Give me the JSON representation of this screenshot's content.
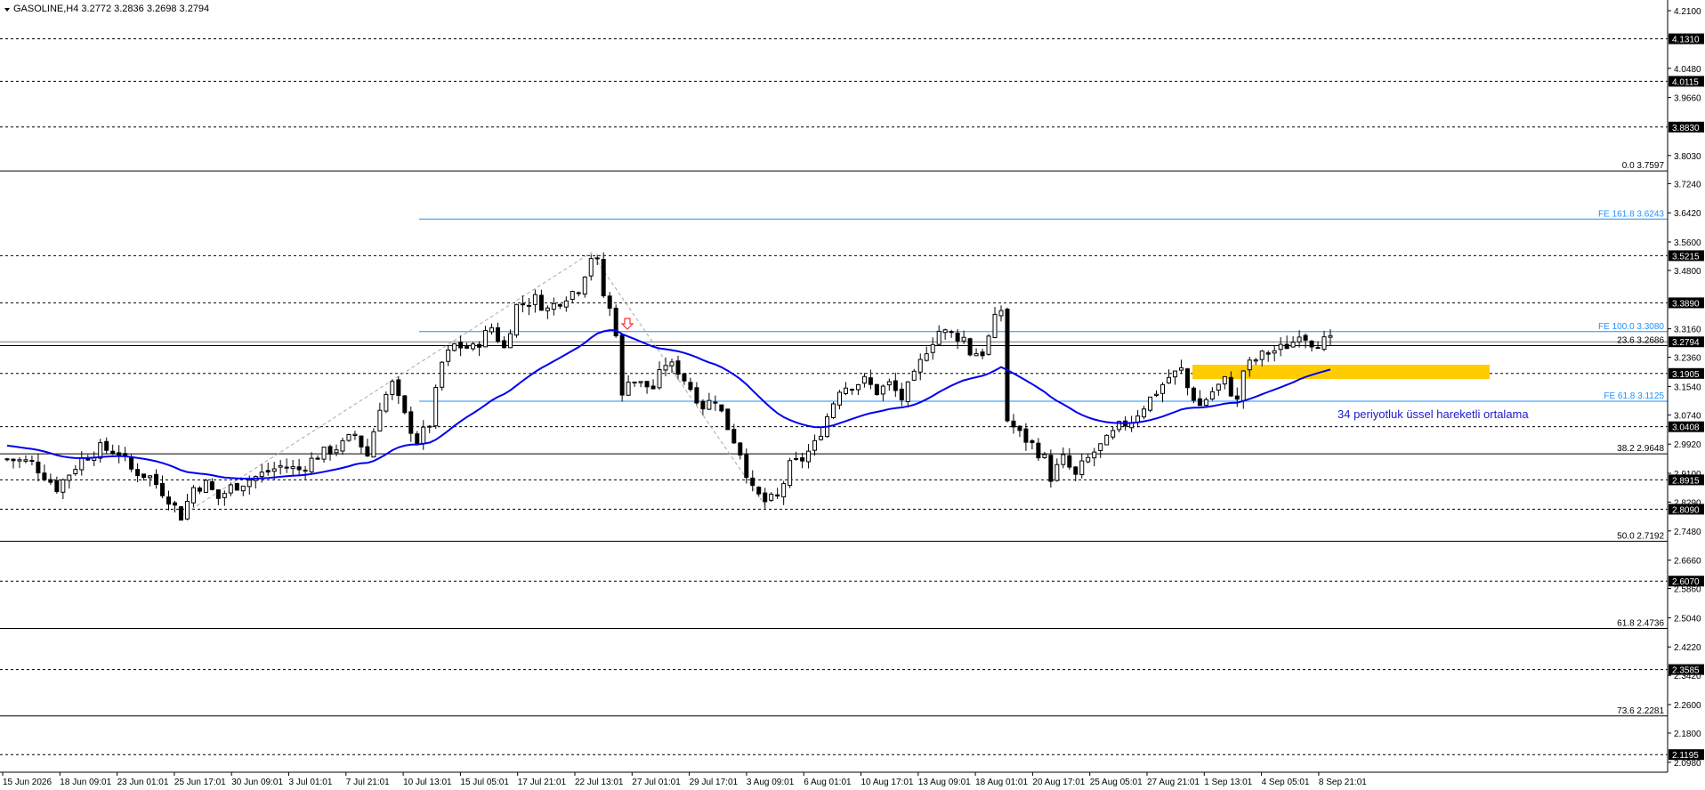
{
  "header": {
    "symbol_label": "GASOLINE,H4  3.2772 3.2836 3.2698 3.2794"
  },
  "colors": {
    "candle": "#000000",
    "ema": "#0000ee",
    "fibo_ext": "#1e90ff",
    "fibo_ext_text": "#1e90ff",
    "zone": "#ffcc00",
    "arrow": "#ff3030",
    "label_bg": "#000000",
    "label_fg": "#ffffff"
  },
  "icons": {
    "sell_arrow": "down-arrow-icon",
    "menu": "triangle-down-icon"
  },
  "chart_data": {
    "type": "candlestick",
    "title": "GASOLINE,H4",
    "ylim": [
      2.07,
      4.23
    ],
    "y_ticks": [
      "4.2100",
      "4.0480",
      "3.9660",
      "3.8030",
      "3.7240",
      "3.6420",
      "3.5600",
      "3.4800",
      "3.3160",
      "3.2360",
      "3.1540",
      "3.0740",
      "2.9920",
      "2.9100",
      "2.8290",
      "2.7480",
      "2.6660",
      "2.5860",
      "2.5040",
      "2.4220",
      "2.3420",
      "2.2600",
      "2.1800",
      "2.0980"
    ],
    "x_labels": [
      "15 Jun 2026",
      "18 Jun 09:01",
      "23 Jun 01:01",
      "25 Jun 17:01",
      "30 Jun 09:01",
      "3 Jul 01:01",
      "7 Jul 21:01",
      "10 Jul 13:01",
      "15 Jul 05:01",
      "17 Jul 21:01",
      "22 Jul 13:01",
      "27 Jul 01:01",
      "29 Jul 17:01",
      "3 Aug 09:01",
      "6 Aug 01:01",
      "10 Aug 17:01",
      "13 Aug 09:01",
      "18 Aug 01:01",
      "20 Aug 17:01",
      "25 Aug 05:01",
      "27 Aug 21:01",
      "1 Sep 13:01",
      "4 Sep 05:01",
      "8 Sep 21:01"
    ],
    "horizontal_levels": [
      {
        "price": 4.131,
        "label": "4.1310",
        "style": "dashed"
      },
      {
        "price": 4.0115,
        "label": "4.0115",
        "style": "dashed"
      },
      {
        "price": 3.883,
        "label": "3.8830",
        "style": "dashed"
      },
      {
        "price": 3.5215,
        "label": "3.5215",
        "style": "dashed"
      },
      {
        "price": 3.389,
        "label": "3.3890",
        "style": "dashed"
      },
      {
        "price": 3.1905,
        "label": "3.1905",
        "style": "dashed"
      },
      {
        "price": 3.0408,
        "label": "3.0408",
        "style": "dashed"
      },
      {
        "price": 2.8915,
        "label": "2.8915",
        "style": "dashed"
      },
      {
        "price": 2.809,
        "label": "2.8090",
        "style": "dashed"
      },
      {
        "price": 2.607,
        "label": "2.6070",
        "style": "dashed"
      },
      {
        "price": 2.3585,
        "label": "2.3585",
        "style": "dashed"
      },
      {
        "price": 2.1195,
        "label": "2.1195",
        "style": "dashed"
      }
    ],
    "fibo_retracement": [
      {
        "price": 3.7597,
        "label": "0.0 3.7597"
      },
      {
        "price": 3.2686,
        "label": "23.6 3.2686"
      },
      {
        "price": 2.9648,
        "label": "38.2 2.9648"
      },
      {
        "price": 2.7192,
        "label": "50.0 2.7192"
      },
      {
        "price": 2.4736,
        "label": "61.8 2.4736"
      },
      {
        "price": 2.2281,
        "label": "73.6 2.2281"
      }
    ],
    "fibo_expansion": [
      {
        "price": 3.6243,
        "label": "FE 161.8 3.6243"
      },
      {
        "price": 3.308,
        "label": "FE 100.0 3.3080"
      },
      {
        "price": 3.1125,
        "label": "FE 61.8 3.1125"
      }
    ],
    "current_price": {
      "price": 3.2794,
      "label": "3.2794"
    },
    "zone": {
      "from": 3.175,
      "to": 3.215
    },
    "annotation": "34 periyotluk üssel hareketli ortalama",
    "close_path": [
      [
        0,
        2.95
      ],
      [
        4,
        2.94
      ],
      [
        8,
        2.87
      ],
      [
        12,
        2.95
      ],
      [
        15,
        2.98
      ],
      [
        18,
        2.97
      ],
      [
        20,
        2.92
      ],
      [
        23,
        2.9
      ],
      [
        26,
        2.84
      ],
      [
        28,
        2.79
      ],
      [
        30,
        2.87
      ],
      [
        32,
        2.88
      ],
      [
        34,
        2.84
      ],
      [
        36,
        2.87
      ],
      [
        40,
        2.9
      ],
      [
        44,
        2.93
      ],
      [
        47,
        2.92
      ],
      [
        50,
        2.96
      ],
      [
        54,
        2.99
      ],
      [
        56,
        3.02
      ],
      [
        58,
        2.96
      ],
      [
        60,
        3.1
      ],
      [
        62,
        3.16
      ],
      [
        64,
        3.07
      ],
      [
        66,
        3.0
      ],
      [
        68,
        3.05
      ],
      [
        70,
        3.22
      ],
      [
        72,
        3.27
      ],
      [
        75,
        3.26
      ],
      [
        78,
        3.32
      ],
      [
        80,
        3.26
      ],
      [
        82,
        3.38
      ],
      [
        85,
        3.4
      ],
      [
        87,
        3.37
      ],
      [
        90,
        3.41
      ],
      [
        92,
        3.43
      ],
      [
        94,
        3.52
      ],
      [
        95,
        3.5
      ],
      [
        96,
        3.41
      ],
      [
        97,
        3.37
      ],
      [
        98,
        3.31
      ],
      [
        99,
        3.12
      ],
      [
        100,
        3.18
      ],
      [
        102,
        3.16
      ],
      [
        104,
        3.15
      ],
      [
        106,
        3.22
      ],
      [
        108,
        3.2
      ],
      [
        110,
        3.15
      ],
      [
        112,
        3.1
      ],
      [
        114,
        3.12
      ],
      [
        116,
        3.04
      ],
      [
        118,
        2.97
      ],
      [
        120,
        2.86
      ],
      [
        122,
        2.83
      ],
      [
        124,
        2.84
      ],
      [
        126,
        2.93
      ],
      [
        128,
        2.95
      ],
      [
        130,
        2.99
      ],
      [
        132,
        3.07
      ],
      [
        134,
        3.15
      ],
      [
        136,
        3.16
      ],
      [
        138,
        3.17
      ],
      [
        140,
        3.14
      ],
      [
        142,
        3.16
      ],
      [
        144,
        3.12
      ],
      [
        146,
        3.18
      ],
      [
        148,
        3.26
      ],
      [
        150,
        3.31
      ],
      [
        152,
        3.3
      ],
      [
        154,
        3.29
      ],
      [
        155,
        3.25
      ],
      [
        157,
        3.25
      ],
      [
        158,
        3.29
      ],
      [
        159,
        3.34
      ],
      [
        160,
        3.37
      ],
      [
        161,
        3.06
      ],
      [
        163,
        3.02
      ],
      [
        165,
        2.99
      ],
      [
        167,
        2.95
      ],
      [
        168,
        2.9
      ],
      [
        170,
        2.95
      ],
      [
        172,
        2.9
      ],
      [
        173,
        2.93
      ],
      [
        175,
        2.97
      ],
      [
        177,
        3.0
      ],
      [
        179,
        3.04
      ],
      [
        181,
        3.06
      ],
      [
        183,
        3.1
      ],
      [
        185,
        3.14
      ],
      [
        187,
        3.18
      ],
      [
        189,
        3.2
      ],
      [
        190,
        3.15
      ],
      [
        192,
        3.1
      ],
      [
        194,
        3.14
      ],
      [
        196,
        3.17
      ],
      [
        198,
        3.11
      ],
      [
        199,
        3.2
      ],
      [
        201,
        3.23
      ],
      [
        203,
        3.25
      ],
      [
        205,
        3.26
      ],
      [
        207,
        3.28
      ],
      [
        208,
        3.31
      ],
      [
        210,
        3.28
      ],
      [
        212,
        3.28
      ]
    ],
    "n_bars": 214
  }
}
